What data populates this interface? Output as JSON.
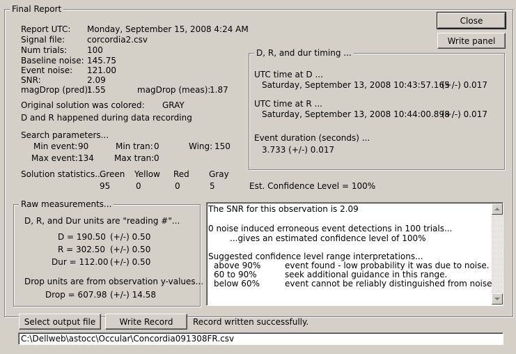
{
  "window": {
    "title": "Final Report"
  },
  "buttons": {
    "close": "Close",
    "write_panel": "Write panel",
    "select_output_file": "Select output file",
    "write_record": "Write Record"
  },
  "report": {
    "utc_label": "Report UTC:",
    "utc_value": "Monday, September 15, 2008 4:24 AM",
    "signal_label": "Signal file:",
    "signal_value": "corcordia2.csv",
    "trials_label": "Num trials:",
    "trials_value": "100",
    "baseline_label": "Baseline noise:",
    "baseline_value": "145.75",
    "event_noise_label": "Event noise:",
    "event_noise_value": "121.00",
    "snr_label": "SNR:",
    "snr_value": "2.09",
    "magdrop_pred_label": "magDrop (pred):",
    "magdrop_pred_value": "1.55",
    "magdrop_meas_label": "magDrop (meas):",
    "magdrop_meas_value": "1.87",
    "original_color_label": "Original solution was colored:",
    "original_color_value": "GRAY",
    "dr_note": "D and R happened during data recording"
  },
  "search": {
    "header": "Search parameters...",
    "min_event_label": "Min event:",
    "min_event_value": "90",
    "max_event_label": "Max event:",
    "max_event_value": "134",
    "min_tran_label": "Min tran:",
    "min_tran_value": "0",
    "max_tran_label": "Max tran:",
    "max_tran_value": "0",
    "wing_label": "Wing:",
    "wing_value": "150"
  },
  "solution_stats": {
    "header": "Solution statistics...",
    "columns": [
      "Green",
      "Yellow",
      "Red",
      "Gray"
    ],
    "values": [
      "95",
      "0",
      "0",
      "5"
    ],
    "confidence": "Est. Confidence Level = 100%"
  },
  "timing": {
    "title": "D, R, and dur timing ...",
    "d_label": "UTC time at D ...",
    "d_value": "Saturday, September 13, 2008 10:43:57.165",
    "d_err": "(+/-)  0.017",
    "r_label": "UTC time at R ...",
    "r_value": "Saturday, September 13, 2008 10:44:00.898",
    "r_err": "(+/-)  0.017",
    "dur_label": "Event duration (seconds) ...",
    "dur_value": "3.733  (+/-)  0.017"
  },
  "raw": {
    "title": "Raw measurements...",
    "units_note": "D, R, and Dur units are \"reading #\"...",
    "d": "D = 190.50",
    "d_err": "(+/-)  0.50",
    "r": "R = 302.50",
    "r_err": "(+/-)  0.50",
    "dur": "Dur = 112.00",
    "dur_err": "(+/-)  0.50",
    "drop_note": "Drop units are from observation y-values...",
    "drop": "Drop = 607.98",
    "drop_err": "(+/-)  14.58"
  },
  "memo": {
    "line1": "The SNR for this observation is 2.09",
    "line2": "0 noise induced erroneous event detections in 100 trials...",
    "line3": "...gives an estimated confidence level of 100%",
    "line4": "Suggested confidence level range interpretations...",
    "r1_range": "above 90%",
    "r1_text": "event found - low probability it was due to noise.",
    "r2_range": "60 to 90%",
    "r2_text": "seek additional guidance in this range.",
    "r3_range": "below 60%",
    "r3_text": "event cannot be reliably distinguished from noise."
  },
  "status": {
    "record_message": "Record written successfully."
  },
  "output_path": {
    "value": "C:\\Dellweb\\astocc\\Occular\\Concordia091308FR.csv"
  },
  "icons": {
    "scroll_up": "up-arrow-icon",
    "scroll_down": "down-arrow-icon"
  }
}
